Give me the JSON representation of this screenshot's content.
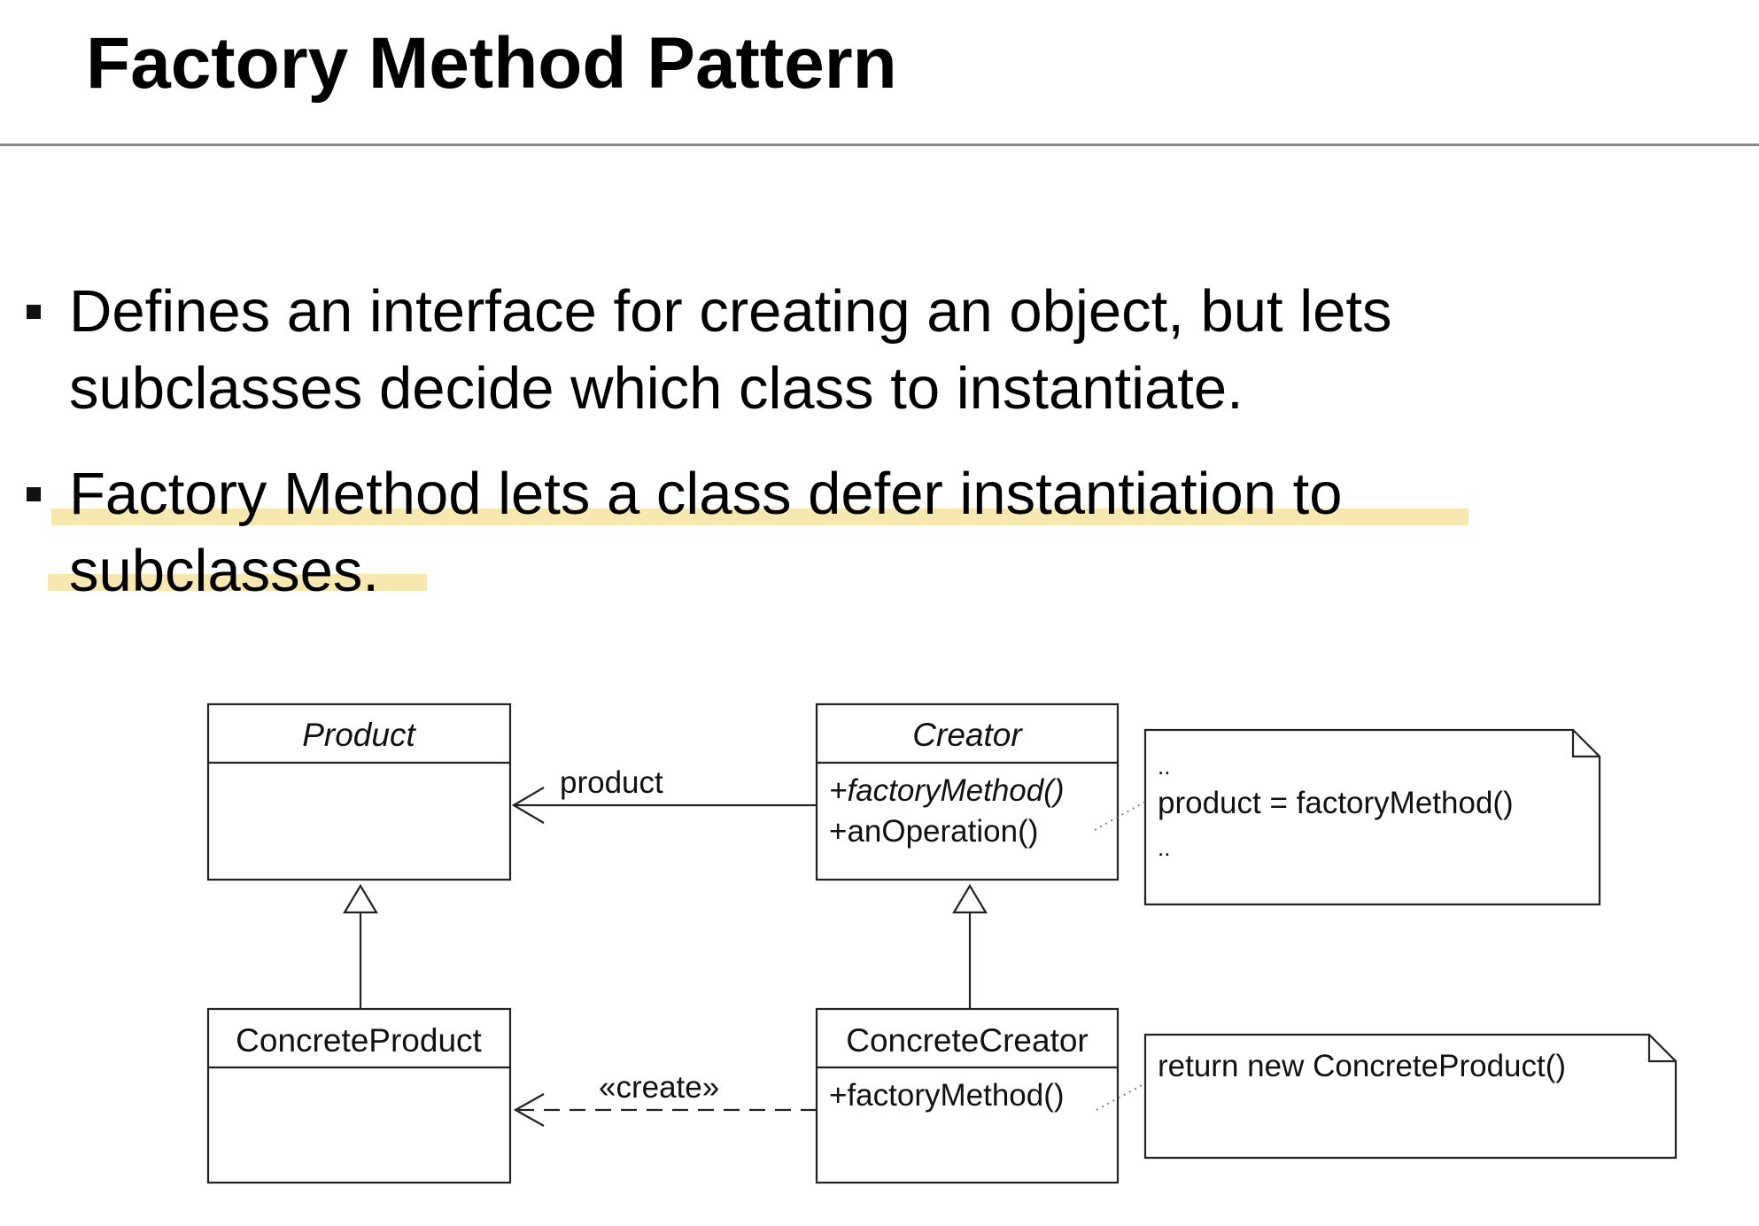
{
  "slide": {
    "title": "Factory Method Pattern",
    "bullets": [
      {
        "lines": [
          "Defines an interface for creating an object, but lets",
          "subclasses decide which class to instantiate."
        ],
        "highlighted": false
      },
      {
        "lines": [
          "Factory Method lets a class defer instantiation to",
          "subclasses."
        ],
        "highlighted": true
      }
    ],
    "highlight_color": "#f0d66e"
  },
  "diagram": {
    "classes": {
      "product": {
        "name": "Product",
        "abstract": true
      },
      "creator": {
        "name": "Creator",
        "abstract": true,
        "operations": [
          "+factoryMethod()",
          "+anOperation()"
        ]
      },
      "concrete_product": {
        "name": "ConcreteProduct"
      },
      "concrete_creator": {
        "name": "ConcreteCreator",
        "operations": [
          "+factoryMethod()"
        ]
      }
    },
    "associations": {
      "product_label": "product",
      "create_label": "«create»"
    },
    "notes": {
      "creator_note": [
        "..",
        "product = factoryMethod()",
        ".."
      ],
      "concrete_creator_note": "return new ConcreteProduct()"
    }
  }
}
